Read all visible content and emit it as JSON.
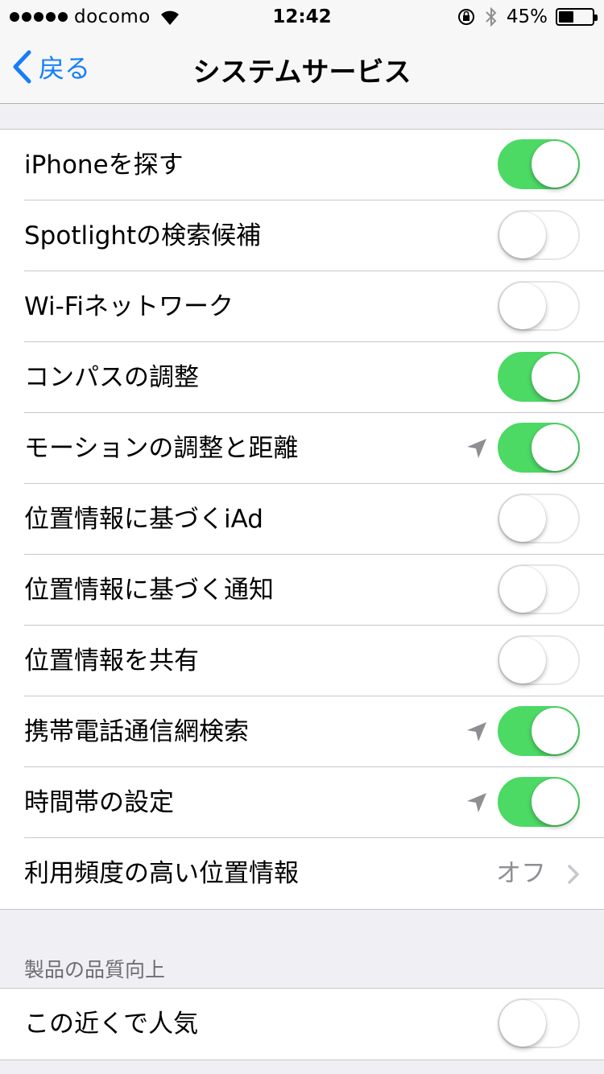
{
  "status_bar": {
    "carrier": "docomo",
    "time": "12:42",
    "battery": "45%",
    "battery_level": 0.45
  },
  "nav": {
    "back_label": "戻る",
    "title": "システムサービス"
  },
  "rows": [
    {
      "label": "iPhoneを探す",
      "on": true,
      "location_arrow": false
    },
    {
      "label": "Spotlightの検索候補",
      "on": false,
      "location_arrow": false
    },
    {
      "label": "Wi-Fiネットワーク",
      "on": false,
      "location_arrow": false
    },
    {
      "label": "コンパスの調整",
      "on": true,
      "location_arrow": false
    },
    {
      "label": "モーションの調整と距離",
      "on": true,
      "location_arrow": true
    },
    {
      "label": "位置情報に基づくiAd",
      "on": false,
      "location_arrow": false
    },
    {
      "label": "位置情報に基づく通知",
      "on": false,
      "location_arrow": false
    },
    {
      "label": "位置情報を共有",
      "on": false,
      "location_arrow": false
    },
    {
      "label": "携帯電話通信網検索",
      "on": true,
      "location_arrow": true
    },
    {
      "label": "時間帯の設定",
      "on": true,
      "location_arrow": true
    },
    {
      "label": "利用頻度の高い位置情報",
      "value": "オフ",
      "disclosure": true
    }
  ],
  "section2": {
    "header": "製品の品質向上",
    "rows": [
      {
        "label": "この近くで人気",
        "on": false
      }
    ]
  },
  "colors": {
    "accent": "#157efb",
    "toggle_on": "#4cd964",
    "separator": "#c8c7cc",
    "background": "#efeff4"
  }
}
